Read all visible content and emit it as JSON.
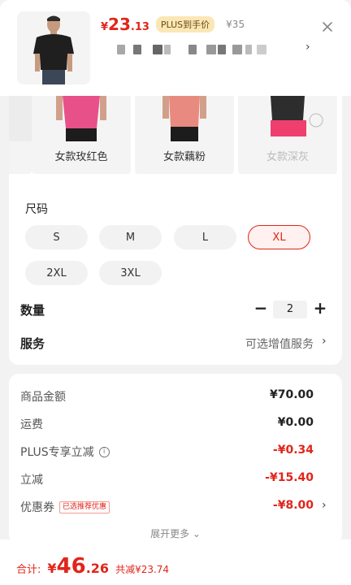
{
  "header": {
    "price_yen": "¥",
    "price_int": "23",
    "price_dec": ".13",
    "plus_badge": "PLUS到手价",
    "orig_price": "¥35",
    "blur_chevron": "›",
    "close_icon": "close-icon"
  },
  "colors": [
    {
      "label": "女款玫红色",
      "swatch": "#e8508a",
      "disabled": false
    },
    {
      "label": "女款藕粉",
      "swatch": "#e98a80",
      "disabled": false
    },
    {
      "label": "女款深灰",
      "swatch": "#ef3f6e",
      "disabled": true
    }
  ],
  "size": {
    "title": "尺码",
    "options": [
      "S",
      "M",
      "L",
      "XL",
      "2XL",
      "3XL"
    ],
    "selected": "XL"
  },
  "quantity": {
    "label": "数量",
    "minus": "−",
    "value": "2",
    "plus": "+"
  },
  "service": {
    "label": "服务",
    "value": "可选增值服务",
    "chevron": "›"
  },
  "summary": {
    "rows": [
      {
        "label": "商品金额",
        "value": "¥70.00"
      },
      {
        "label": "运费",
        "value": "¥0.00"
      },
      {
        "label": "PLUS专享立减",
        "value": "-¥0.34",
        "info": "i"
      },
      {
        "label": "立减",
        "value": "-¥15.40"
      },
      {
        "label": "优惠券",
        "value": "-¥8.00",
        "tag": "已选推荐优惠",
        "chevron": "›"
      }
    ],
    "expand": "展开更多 ⌄"
  },
  "footer": {
    "total_label": "合计:",
    "total_yen": "¥",
    "total_int": "46",
    "total_dec": ".26",
    "save_text": "共减¥23.74"
  },
  "colors_theme": {
    "accent": "#e1251b",
    "plus_badge_bg": "#fbe7b5"
  }
}
